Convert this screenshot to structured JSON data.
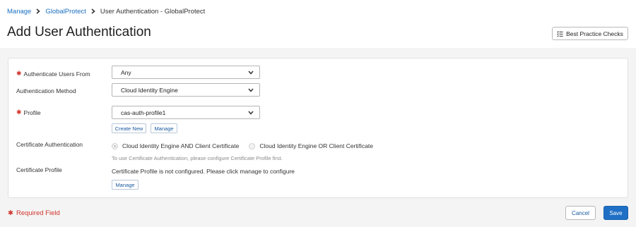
{
  "breadcrumb": {
    "items": [
      "Manage",
      "GlobalProtect",
      "User Authentication - GlobalProtect"
    ],
    "separator_icon": "chevron-right-icon"
  },
  "page": {
    "title": "Add User Authentication",
    "best_practice_label": "Best Practice Checks"
  },
  "form": {
    "authenticate_users_from": {
      "label": "Authenticate Users From",
      "required": true,
      "value": "Any"
    },
    "authentication_method": {
      "label": "Authentication Method",
      "required": false,
      "value": "Cloud Identity Engine"
    },
    "profile": {
      "label": "Profile",
      "required": true,
      "value": "cas-auth-profile1",
      "create_new_label": "Create New",
      "manage_label": "Manage"
    },
    "certificate_authentication": {
      "label": "Certificate Authentication",
      "options": [
        "Cloud Identity Engine AND Client Certificate",
        "Cloud Identity Engine OR Client Certificate"
      ],
      "selected_index": 0,
      "hint": "To use Certificate Authentication, please configure Certificate Profile first."
    },
    "certificate_profile": {
      "label": "Certificate Profile",
      "message": "Certificate Profile is not configured. Please click manage to configure",
      "manage_label": "Manage"
    }
  },
  "footer": {
    "required_note": "Required Field",
    "cancel_label": "Cancel",
    "save_label": "Save"
  },
  "colors": {
    "link": "#1a6fc2",
    "required": "#d0342c",
    "primary": "#1f6fc5"
  }
}
